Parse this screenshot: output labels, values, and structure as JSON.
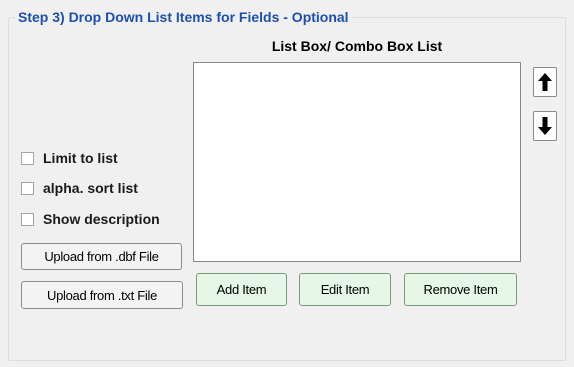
{
  "group": {
    "title": "Step 3) Drop Down List Items for Fields - Optional"
  },
  "list": {
    "caption": "List Box/ Combo Box List",
    "items": []
  },
  "arrows": {
    "up_icon": "arrow-up-icon",
    "down_icon": "arrow-down-icon"
  },
  "options": {
    "limit_to_list": "Limit to list",
    "alpha_sort_list": "alpha. sort list",
    "show_description": "Show description"
  },
  "buttons": {
    "upload_dbf": "Upload from .dbf File",
    "upload_txt": "Upload from .txt File",
    "add_item": "Add Item",
    "edit_item": "Edit Item",
    "remove_item": "Remove Item"
  },
  "colors": {
    "title": "#1d4fb0",
    "item_button_bg": "#e6f7e6"
  }
}
